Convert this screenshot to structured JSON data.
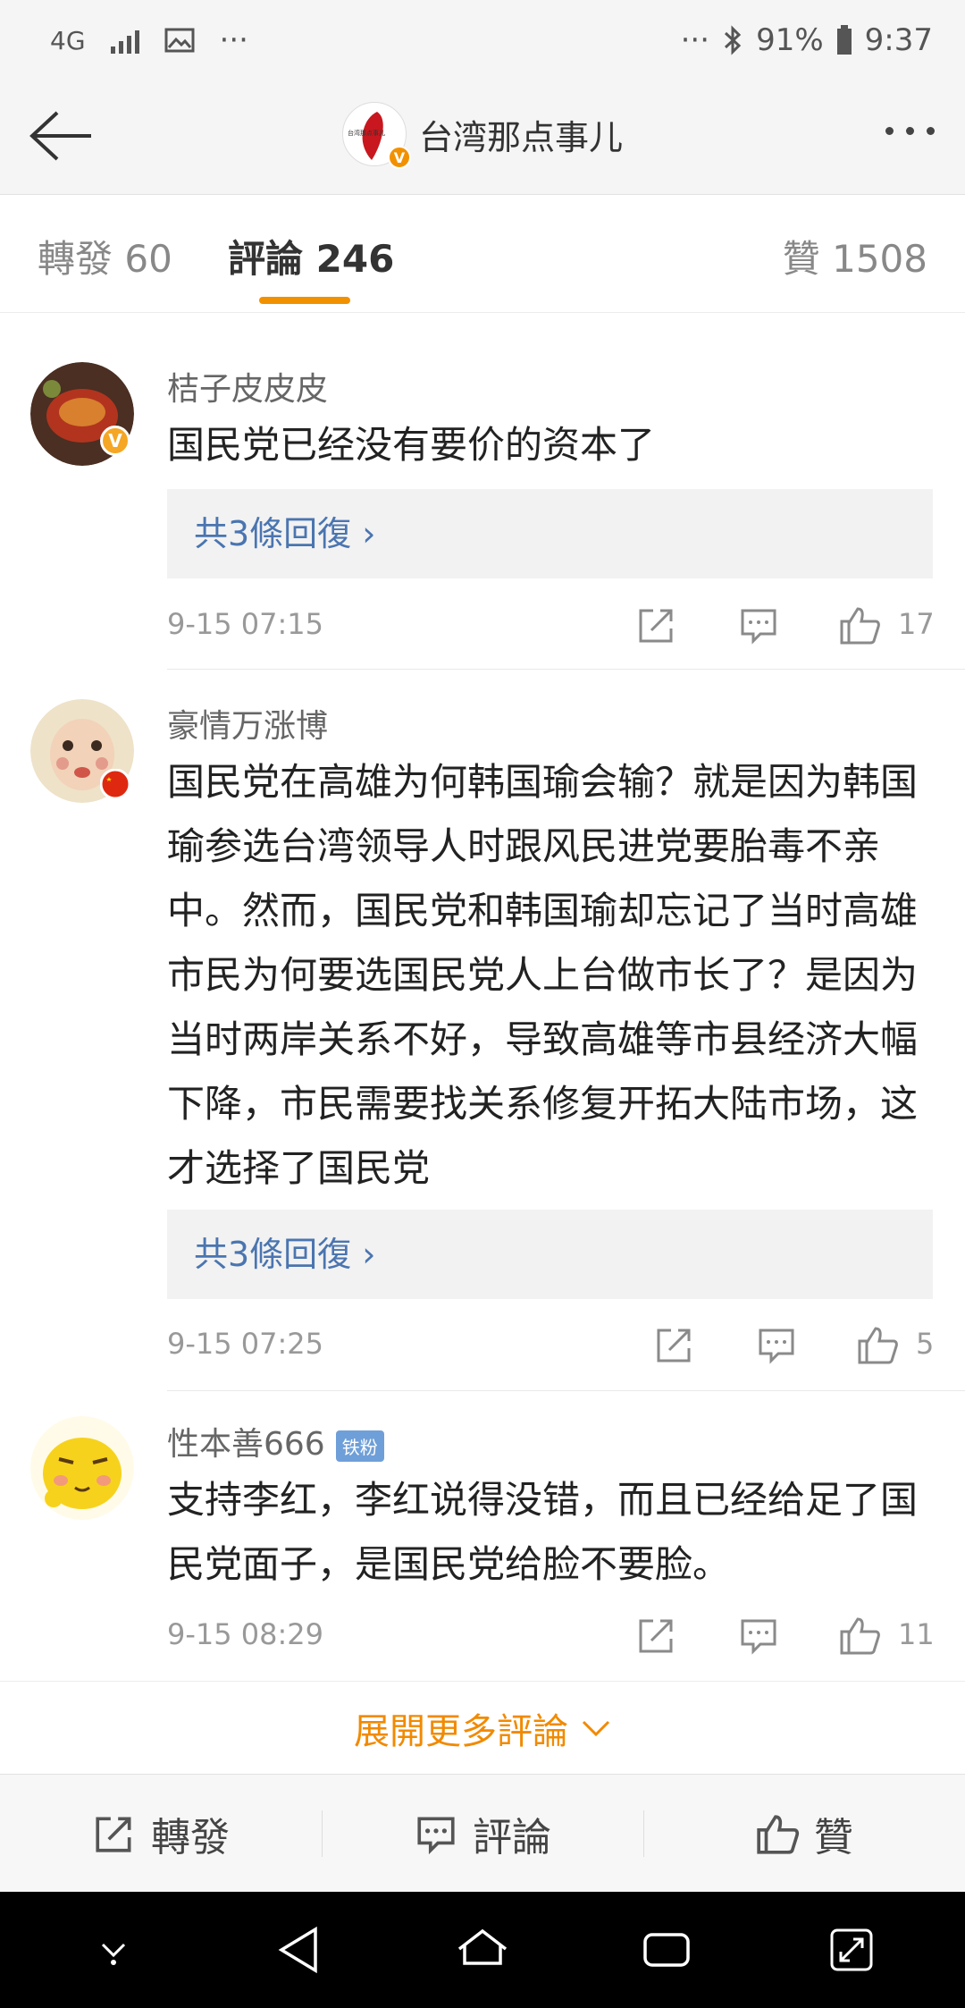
{
  "status_bar": {
    "network": "4G",
    "left_dots": "···",
    "right_dots": "···",
    "battery": "91%",
    "time": "9:37"
  },
  "header": {
    "title": "台湾那点事儿",
    "verified": "V"
  },
  "tabs": {
    "repost": "轉發 60",
    "comments": "評論 246",
    "likes": "贊 1508"
  },
  "comments": [
    {
      "user": "桔子皮皮皮",
      "verified": "V",
      "text": "国民党已经没有要价的资本了",
      "replies": "共3條回復 ›",
      "time": "9-15 07:15",
      "likes": "17"
    },
    {
      "user": "豪情万涨博",
      "text": "国民党在高雄为何韩国瑜会输？就是因为韩国瑜参选台湾领导人时跟风民进党要胎毒不亲中。然而，国民党和韩国瑜却忘记了当时高雄市民为何要选国民党人上台做市长了？是因为当时两岸关系不好，导致高雄等市县经济大幅下降，市民需要找关系修复开拓大陆市场，这才选择了国民党",
      "replies": "共3條回復 ›",
      "time": "9-15 07:25",
      "likes": "5"
    },
    {
      "user": "性本善666",
      "fan_badge": "铁粉",
      "text": "支持李红，李红说得没错，而且已经给足了国民党面子，是国民党给脸不要脸。",
      "time": "9-15 08:29",
      "likes": "11"
    }
  ],
  "expand_more": "展開更多評論",
  "bottom_bar": {
    "repost": "轉發",
    "comment": "評論",
    "like": "贊"
  },
  "colors": {
    "accent": "#f29100",
    "link": "#4a75b0",
    "fan_badge": "#6f9fd8"
  }
}
